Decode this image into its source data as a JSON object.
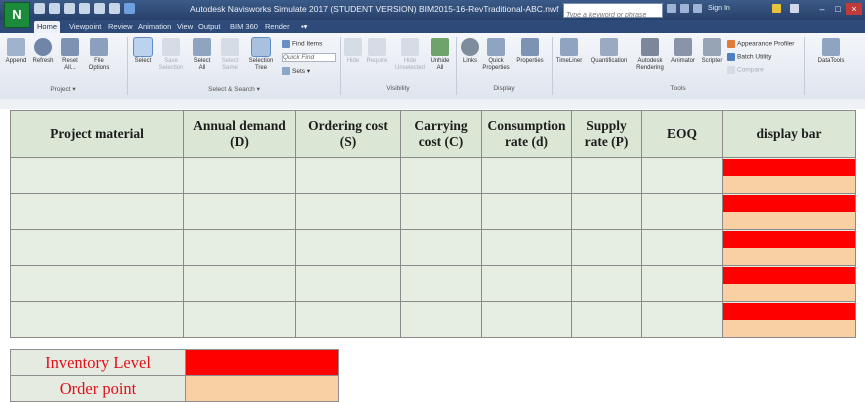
{
  "app": {
    "logo": "N",
    "title": "Autodesk Navisworks Simulate 2017 (STUDENT VERSION)   BIM2015-16-RevTraditional-ABC.nwf",
    "search_placeholder": "Type a keyword or phrase",
    "sign_in": "Sign In"
  },
  "tabs": [
    "Home",
    "Viewpoint",
    "Review",
    "Animation",
    "View",
    "Output",
    "BIM 360",
    "Render"
  ],
  "ribbon": {
    "project": {
      "label": "Project",
      "buttons": [
        "Append",
        "Refresh",
        "Reset All...",
        "File Options"
      ]
    },
    "select_search": {
      "label": "Select & Search",
      "buttons": [
        "Select",
        "Save Selection",
        "Select All",
        "Select Same",
        "Selection Tree"
      ],
      "small": [
        "Find Items",
        "Quick Find",
        "Sets"
      ]
    },
    "visibility": {
      "label": "Visibility",
      "buttons": [
        "Hide",
        "Require",
        "Hide Unselected",
        "Unhide All"
      ]
    },
    "display": {
      "label": "Display",
      "buttons": [
        "Links",
        "Quick Properties",
        "Properties"
      ]
    },
    "tools": {
      "label": "Tools",
      "buttons": [
        "TimeLiner",
        "Quantification",
        "Autodesk Rendering",
        "Animator",
        "Scripter"
      ],
      "small": [
        "Appearance Profiler",
        "Batch Utility",
        "Compare"
      ]
    },
    "datatools": "DataTools"
  },
  "table": {
    "headers": [
      "Project material",
      "Annual demand\n(D)",
      "Ordering cost\n(S)",
      "Carrying\ncost (C)",
      "Consumption\nrate (d)",
      "Supply\nrate (P)",
      "EOQ",
      "display bar"
    ],
    "row_count": 5
  },
  "legend": [
    {
      "label": "Inventory Level",
      "color": "#ff0000"
    },
    {
      "label": "Order point",
      "color": "#f9cfa4"
    }
  ],
  "colors": {
    "inventory_level": "#ff0000",
    "order_point": "#f9cfa4",
    "header_bg": "#dbe6d4",
    "cell_bg": "#e6eee2"
  }
}
